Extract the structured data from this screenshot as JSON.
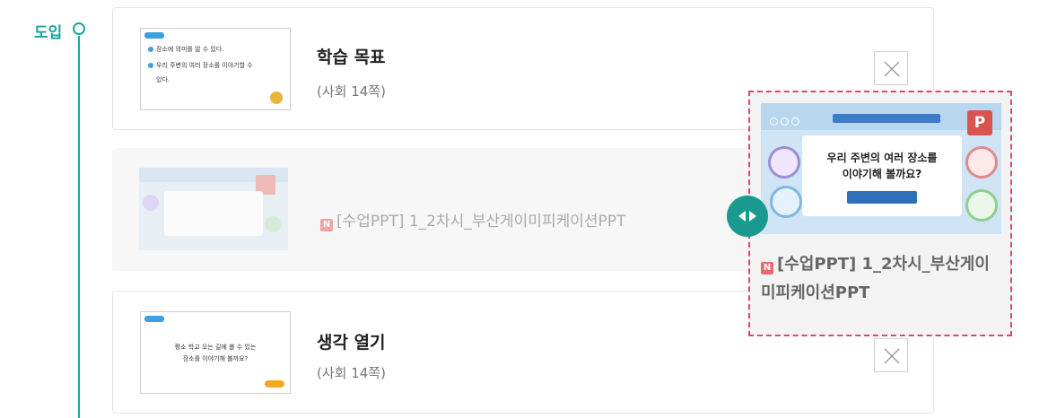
{
  "stage": {
    "label": "도입"
  },
  "cards": [
    {
      "title": "학습 목표",
      "subtitle": "(사회 14쪽)",
      "thumb_lines": [
        "장소에 의미를 알 수 있다.",
        "우리 주변의 여러 장소를 이야기할 수",
        "있다."
      ]
    },
    {
      "title": "생각 열기",
      "subtitle": "(사회 14쪽)",
      "thumb_lines": [
        "평소 학교 오는 길에 볼 수 있는",
        "장소를 이야기해 볼까요?"
      ]
    }
  ],
  "ghost_item": {
    "badge": "N",
    "title": "[수업PPT] 1_2차시_부산게이미피케이션PPT"
  },
  "drag_preview": {
    "badge": "N",
    "title": "[수업PPT] 1_2차시_부산게이미피케이션PPT",
    "thumb_p": "P",
    "thumb_question_line1": "우리 주변의 여러 장소를",
    "thumb_question_line2": "이야기해 볼까요?"
  },
  "colors": {
    "accent": "#1aa6a0",
    "drag_border": "#e0427a",
    "ppt_badge": "#d9534f"
  }
}
